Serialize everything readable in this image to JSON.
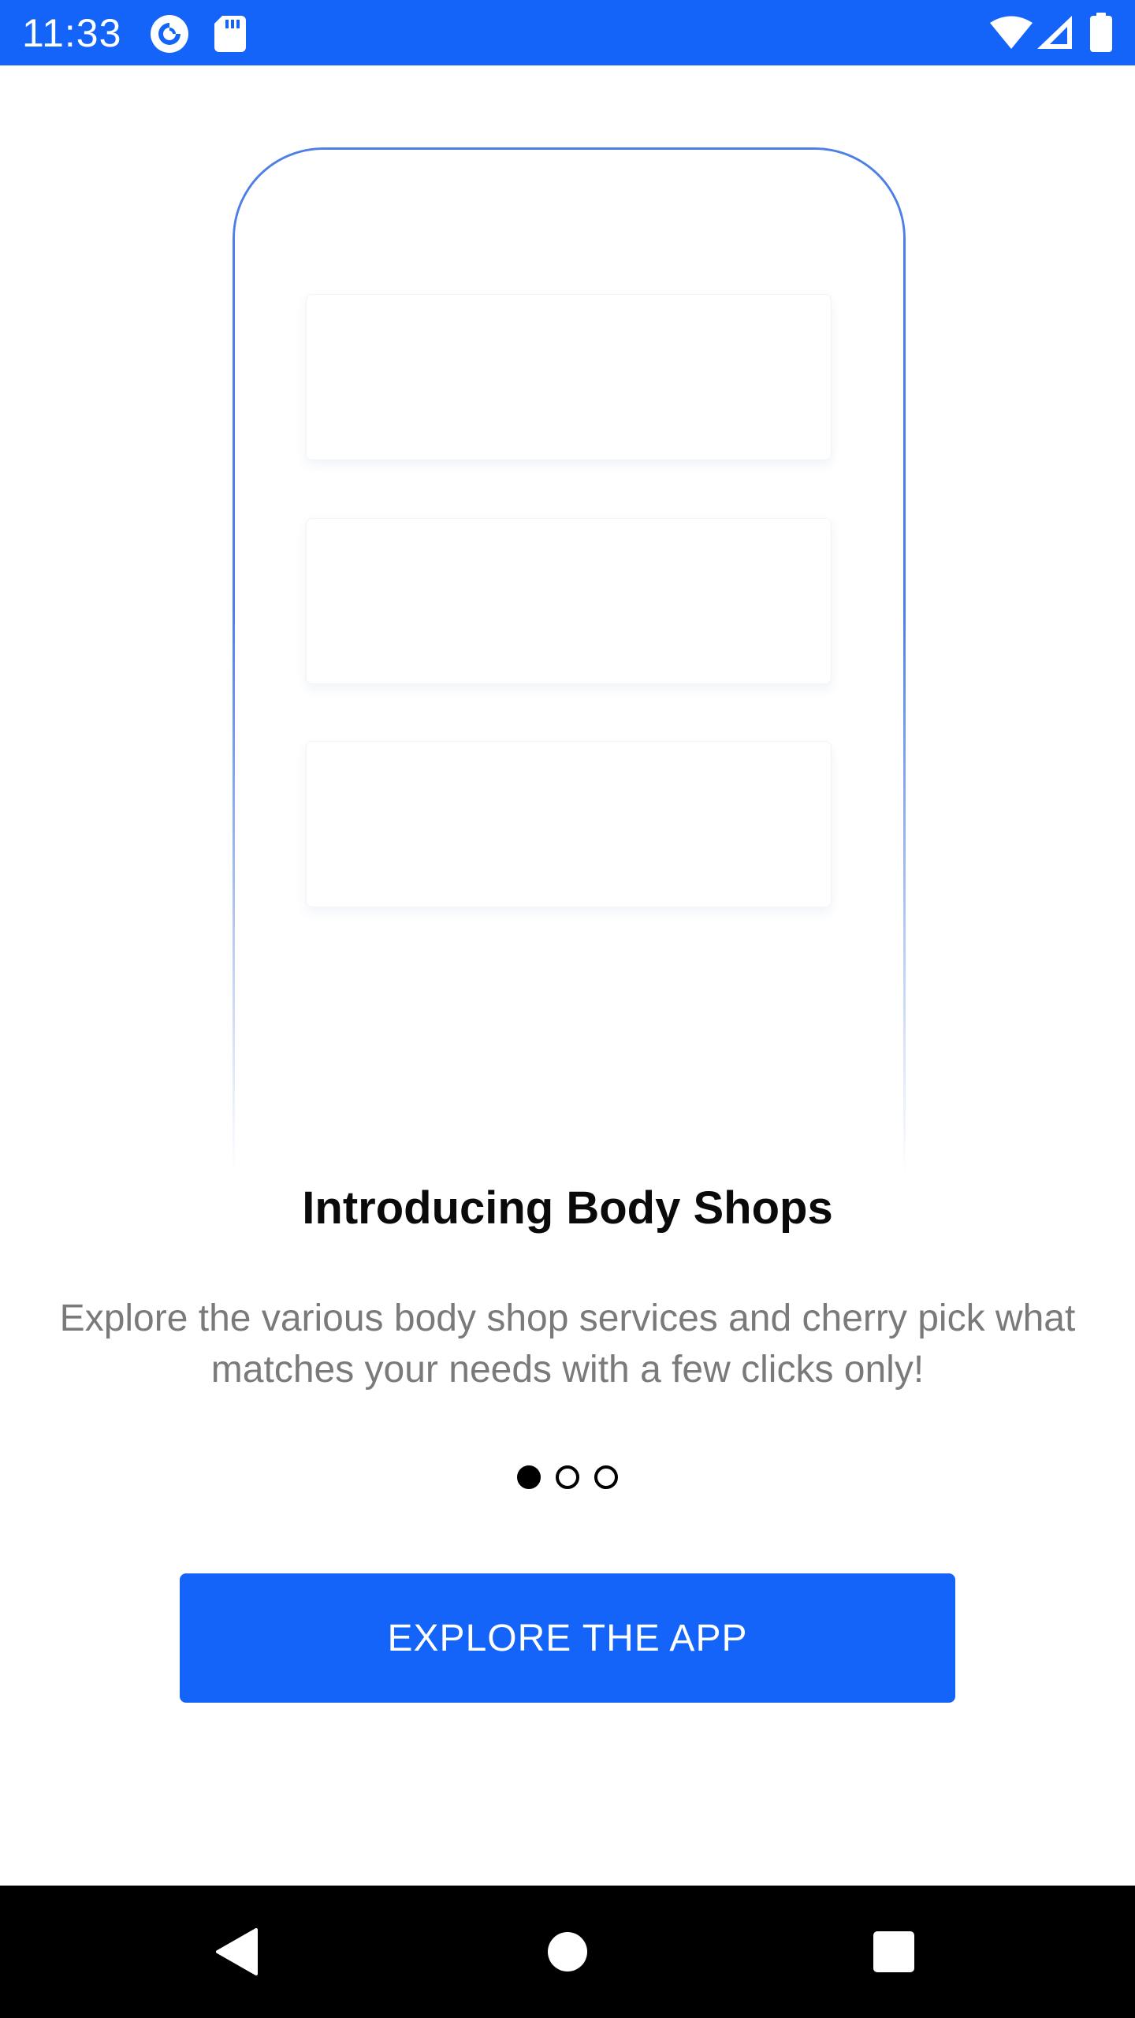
{
  "status_bar": {
    "time": "11:33",
    "left_icons": [
      "pocket-casts-icon",
      "sd-card-icon"
    ],
    "right_icons": [
      "wifi-icon",
      "cell-signal-icon",
      "battery-icon"
    ],
    "color": "#1464fa"
  },
  "illustration": {
    "outline_color": "#4d7fe6",
    "cards": [
      "placeholder-card",
      "placeholder-card",
      "placeholder-card"
    ]
  },
  "onboarding": {
    "title": "Introducing Body Shops",
    "description": "Explore the various body shop services and cherry pick what matches your needs with a few clicks only!",
    "page_indicator": {
      "total": 3,
      "current": 1
    },
    "cta_label": "EXPLORE THE APP",
    "cta_color": "#1464fa"
  },
  "nav_bar": {
    "buttons": [
      "back-icon",
      "home-icon",
      "recents-icon"
    ]
  }
}
